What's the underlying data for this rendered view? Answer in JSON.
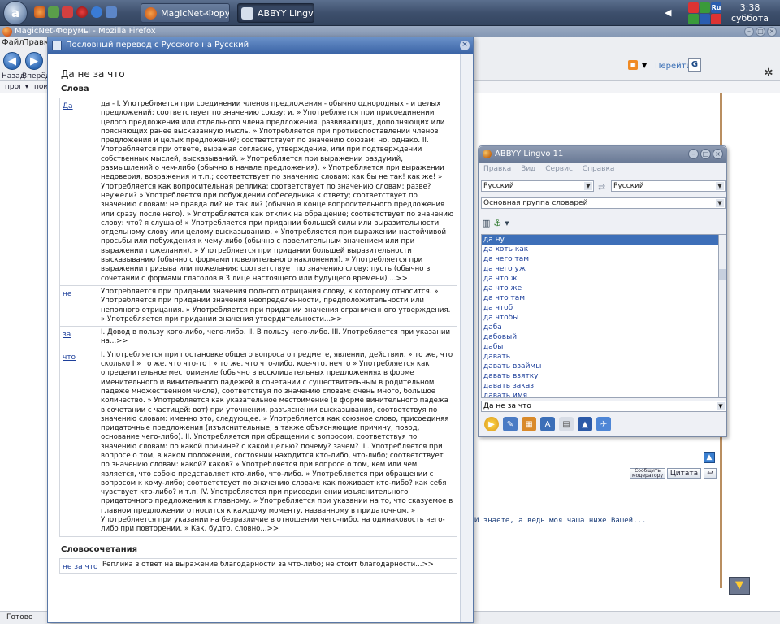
{
  "taskbar": {
    "start_glyph": "a",
    "tasks": [
      {
        "label": "MagicNet-Форум...",
        "active": false
      },
      {
        "label": "ABBYY Lingvo 11",
        "active": true
      }
    ],
    "tray": {
      "lang": "Ru"
    },
    "clock": {
      "time": "3:38",
      "day": "суббота"
    }
  },
  "firefox": {
    "title": "MagicNet-Форумы - Mozilla Firefox",
    "menu": [
      "Файл",
      "Правка"
    ],
    "back_label": "Назад",
    "forward_label": "Вперёд",
    "bookmarks": [
      "прог ▾",
      "поис"
    ],
    "go_label": "Перейти",
    "status": "Готово",
    "reply_button": "Сообщить модератору",
    "quote_button": "Цитата",
    "post_snippet": "И знаете, а ведь моя чаша ниже Вашей..."
  },
  "popup": {
    "title": "Пословный перевод с Русского на Русский",
    "query": "Да не за что",
    "words_heading": "Слова",
    "phrases_heading": "Словосочетания",
    "entries": [
      {
        "word": "Да",
        "text": "да - I. Употребляется при соединении членов предложения - обычно однородных - и целых предложений; соответствует по значению союзу: и. » Употребляется при присоединении целого предложения или отдельного члена предложения, развивающих, дополняющих или поясняющих ранее высказанную мысль. » Употребляется при противопоставлении членов предложения и целых предложений; соответствует по значению союзам: но, однако. II. Употребляется при ответе, выражая согласие, утверждение, или при подтверждении собственных мыслей, высказываний. » Употребляется при выражении раздумий, размышлений о чем-либо (обычно в начале предложения). » Употребляется при выражении недоверия, возражения и т.п.; соответствует по значению словам: как бы не так! как же! » Употребляется как вопросительная реплика; соответствует по значению словам: разве? неужели? » Употребляется при побуждении собеседника к ответу; соответствует по значению словам: не правда ли? не так ли? (обычно в конце вопросительного предложения или сразу после него). » Употребляется как отклик на обращение; соответствует по значению слову: что? я слушаю! » Употребляется при придании большей силы или выразительности отдельному слову или целому высказыванию. » Употребляется при выражении настойчивой просьбы или побуждения к чему-либо (обычно с повелительным значением или при выражении пожелания). » Употребляется при придании большей выразительности высказыванию (обычно с формами повелительного наклонения). » Употребляется при выражении призыва или пожелания; соответствует по значению слову: пусть (обычно в сочетании с формами глаголов в 3 лице настоящего или будущего времени) ...>>"
      },
      {
        "word": "не",
        "text": "Употребляется при придании значения полного отрицания слову, к которому относится. » Употребляется при придании значения неопределенности, предположительности или неполного отрицания. » Употребляется при придании значения ограниченного утверждения. » Употребляется при придании значения утвердительности...>>"
      },
      {
        "word": "за",
        "text": "I. Довод в пользу кого-либо, чего-либо. II. В пользу чего-либо. III. Употребляется при указании на...>>"
      },
      {
        "word": "что",
        "text": "I. Употребляется при постановке общего вопроса о предмете, явлении, действии. » то же, что сколько I » то же, что что-то I » то же, что что-либо, кое-что, нечто » Употребляется как определительное местоимение (обычно в восклицательных предложениях в форме именительного и винительного падежей в сочетании с существительным в родительном падеже множественном числе), соответствуя по значению словам: очень много, большое количество. » Употребляется как указательное местоимение (в форме винительного падежа в сочетании с частицей: вот) при уточнении, разъяснении высказывания, соответствуя по значению словам: именно это, следующее. » Употребляется как союзное слово, присоединяя придаточные предложения (изъяснительные, а также объясняющие причину, повод, основание чего-либо). II. Употребляется при обращении с вопросом, соответствуя по значению словам: по какой причине? с какой целью? почему? зачем? III. Употребляется при вопросе о том, в каком положении, состоянии находится кто-либо, что-либо; соответствует по значению словам: какой? каков? » Употребляется при вопросе о том, кем или чем является, что собою представляет кто-либо, что-либо. » Употребляется при обращении с вопросом к кому-либо; соответствует по значению словам: как поживает кто-либо? как себя чувствует кто-либо? и т.п. IV. Употребляется при присоединении изъяснительного придаточного предложения к главному. » Употребляется при указании на то, что сказуемое в главном предложении относится к каждому моменту, названному в придаточном. » Употребляется при указании на безразличие в отношении чего-либо, на одинаковость чего-либо при повторении. » Как, будто, словно...>>"
      }
    ],
    "phrases": [
      {
        "word": "не за что",
        "text": "Реплика в ответ на выражение благодарности за что-либо; не стоит благодарности...>>"
      }
    ]
  },
  "lingvo": {
    "title": "ABBYY Lingvo 11",
    "menu": [
      "Правка",
      "Вид",
      "Сервис",
      "Справка"
    ],
    "from_lang": "Русский",
    "to_lang": "Русский",
    "dict_group": "Основная группа словарей",
    "input_value": "Да не за что",
    "list": [
      "да ну",
      "да хоть как",
      "да чего там",
      "да чего уж",
      "да что ж",
      "да что же",
      "да что там",
      "да чтоб",
      "да чтобы",
      "даба",
      "дабовый",
      "дабы",
      "давать",
      "давать взаймы",
      "давать взятку",
      "давать заказ",
      "давать имя"
    ],
    "selected_index": 0
  }
}
